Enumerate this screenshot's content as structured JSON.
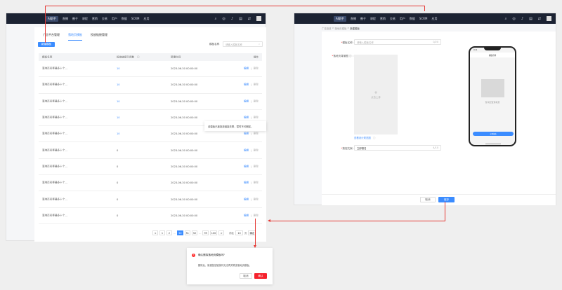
{
  "nav": {
    "items": [
      "AI助手",
      "直播",
      "圈子",
      "课程",
      "营销",
      "交易",
      "用户",
      "数据",
      "SCRM",
      "应用"
    ]
  },
  "left": {
    "tabs": [
      "广告平台管理",
      "落地页模板",
      "投放链接管理"
    ],
    "new_button": "新建模板",
    "search_label": "模板名称",
    "search_placeholder": "请输入模板名称",
    "columns": [
      "模板名称",
      "投放链接引用数",
      "新建时间",
      "操作"
    ],
    "rows": [
      {
        "name": "落地页名称最多十个...",
        "refs": "10",
        "time": "2023-06-30 00:00:00"
      },
      {
        "name": "落地页名称最多十个...",
        "refs": "10",
        "time": "2023-06-30 00:00:00"
      },
      {
        "name": "落地页名称最多十个...",
        "refs": "10",
        "time": "2023-06-30 00:00:00"
      },
      {
        "name": "落地页名称最多十个...",
        "refs": "10",
        "time": "2023-06-30 00:00:00"
      },
      {
        "name": "落地页名称最多十个...",
        "refs": "10",
        "time": "2023-06-30 00:00:00"
      },
      {
        "name": "落地页名称最多十个...",
        "refs": "0",
        "time": "2023-06-30 00:00:00"
      },
      {
        "name": "落地页名称最多十个...",
        "refs": "0",
        "time": "2023-06-30 00:00:00"
      },
      {
        "name": "落地页名称最多十个...",
        "refs": "0",
        "time": "2023-06-30 00:00:00"
      },
      {
        "name": "落地页名称最多十个...",
        "refs": "0",
        "time": "2023-06-30 00:00:00"
      },
      {
        "name": "落地页名称最多十个...",
        "refs": "0",
        "time": "2023-06-30 00:00:00"
      }
    ],
    "edit": "编辑",
    "sep": "|",
    "delete": "删除",
    "tooltip": "该模板已被投放链接关联，暂时不可删除。",
    "pagination": {
      "prev": "<",
      "pages": [
        "1",
        "2",
        "...",
        "50",
        "51",
        "52",
        "...",
        "99",
        "100"
      ],
      "current": "50",
      "next": ">",
      "goto": "前往",
      "goto_value": "10",
      "page_unit": "页",
      "confirm": "确定"
    }
  },
  "modal": {
    "title": "确认删除落地页模板吗?",
    "body": "删除后，新建投放链接将无法再关联该落地页模板。",
    "cancel": "取消",
    "confirm": "确认"
  },
  "right": {
    "breadcrumb": [
      "广告投放",
      ">",
      "落地页模板",
      ">",
      "新建模板"
    ],
    "name_label": "模板名称:",
    "name_placeholder": "请输入模板名称",
    "name_count": "0/20",
    "bg_label": "落地页背景图",
    "upload_plus": "+",
    "upload_text": "点击上传",
    "example_link": "查看设计规范图",
    "btn_label": "按钮文案:",
    "btn_value": "立即报名",
    "btn_count": "4/10",
    "phone": {
      "time": "9:41",
      "title": "模板名称",
      "placeholder": "暂未配置落地页",
      "button": "立即报名"
    },
    "cancel": "取消",
    "save": "保存"
  }
}
